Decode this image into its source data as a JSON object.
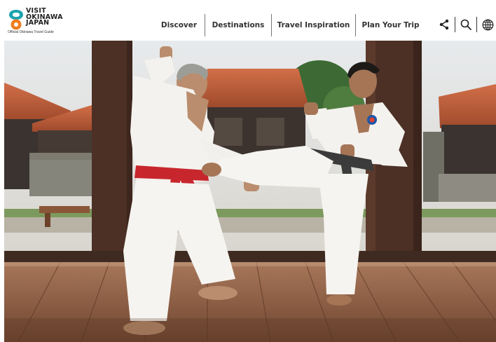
{
  "brand": {
    "line1": "VISIT",
    "line2": "OKINAWA",
    "line3": "JAPAN",
    "tagline": "Official Okinawa Travel Guide",
    "colors": {
      "teal": "#1da3b0",
      "orange": "#ee7d1f"
    }
  },
  "nav": {
    "items": [
      {
        "label": "Discover"
      },
      {
        "label": "Destinations"
      },
      {
        "label": "Travel Inspiration"
      },
      {
        "label": "Plan Your Trip"
      }
    ]
  },
  "tools": {
    "icons": [
      "share-icon",
      "search-icon",
      "globe-icon"
    ]
  },
  "hero": {
    "subject": "karate-kick-photo",
    "colors": {
      "belt_red": "#c8262d",
      "belt_black": "#3b3b3b",
      "roof": "#c4603b",
      "floor": "#8a5a3c"
    }
  }
}
